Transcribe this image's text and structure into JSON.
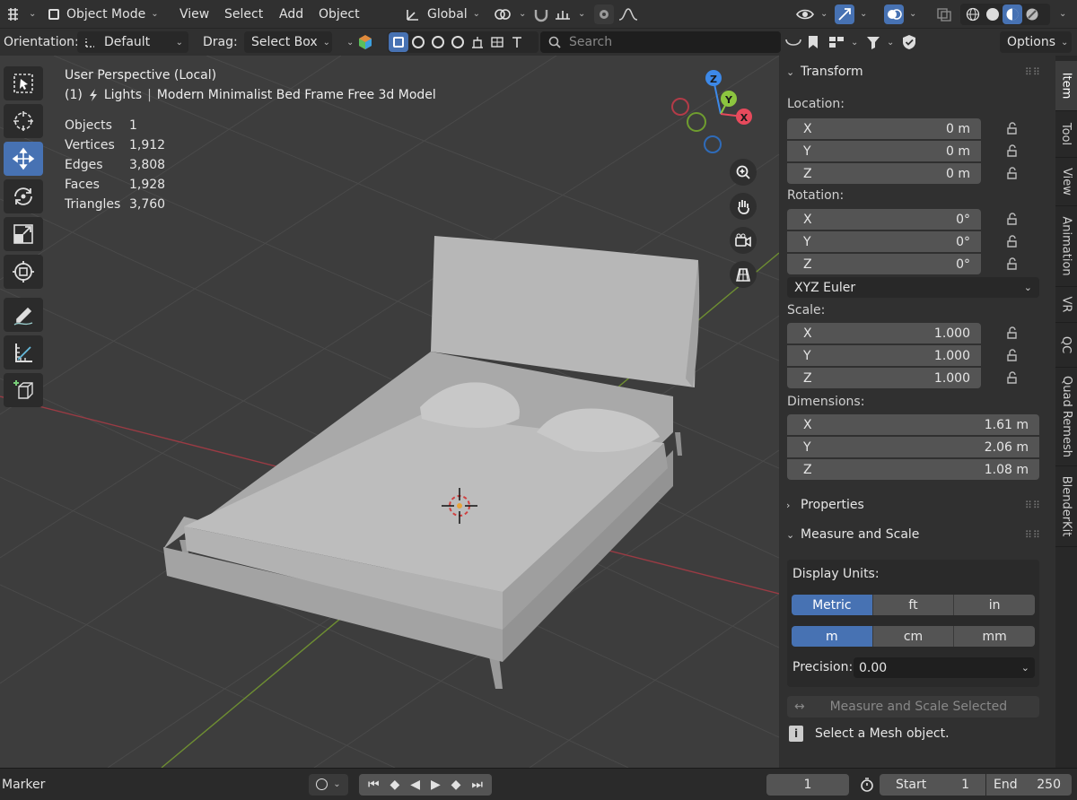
{
  "header": {
    "mode": "Object Mode",
    "menus": [
      "View",
      "Select",
      "Add",
      "Object"
    ],
    "transform_orientation": "Global",
    "options_label": "Options"
  },
  "toolsettings": {
    "orientation_label": "Orientation:",
    "orientation_value": "Default",
    "drag_label": "Drag:",
    "drag_value": "Select Box",
    "search_placeholder": "Search"
  },
  "viewport": {
    "view_name": "User Perspective (Local)",
    "frame_prefix": "(1)",
    "collection": "Lights",
    "object_name": "Modern Minimalist Bed Frame Free 3d Model",
    "stats": [
      {
        "label": "Objects",
        "value": "1"
      },
      {
        "label": "Vertices",
        "value": "1,912"
      },
      {
        "label": "Edges",
        "value": "3,808"
      },
      {
        "label": "Faces",
        "value": "1,928"
      },
      {
        "label": "Triangles",
        "value": "3,760"
      }
    ],
    "gizmo": {
      "x": "X",
      "y": "Y",
      "z": "Z"
    }
  },
  "sidebar": {
    "transform_title": "Transform",
    "location_label": "Location:",
    "location": [
      {
        "axis": "X",
        "value": "0 m"
      },
      {
        "axis": "Y",
        "value": "0 m"
      },
      {
        "axis": "Z",
        "value": "0 m"
      }
    ],
    "rotation_label": "Rotation:",
    "rotation": [
      {
        "axis": "X",
        "value": "0°"
      },
      {
        "axis": "Y",
        "value": "0°"
      },
      {
        "axis": "Z",
        "value": "0°"
      }
    ],
    "rotation_mode": "XYZ Euler",
    "scale_label": "Scale:",
    "scale": [
      {
        "axis": "X",
        "value": "1.000"
      },
      {
        "axis": "Y",
        "value": "1.000"
      },
      {
        "axis": "Z",
        "value": "1.000"
      }
    ],
    "dimensions_label": "Dimensions:",
    "dimensions": [
      {
        "axis": "X",
        "value": "1.61 m"
      },
      {
        "axis": "Y",
        "value": "2.06 m"
      },
      {
        "axis": "Z",
        "value": "1.08 m"
      }
    ],
    "properties_title": "Properties",
    "measure_title": "Measure and Scale",
    "display_units_label": "Display Units:",
    "unit_systems": [
      "Metric",
      "ft",
      "in"
    ],
    "length_units": [
      "m",
      "cm",
      "mm"
    ],
    "precision_label": "Precision:",
    "precision_value": "0.00",
    "measure_button": "Measure and Scale Selected",
    "info_text": "Select a Mesh object."
  },
  "tabs": [
    "Item",
    "Tool",
    "View",
    "Animation",
    "VR",
    "QC",
    "Quad Remesh",
    "BlenderKit"
  ],
  "timeline": {
    "marker_label": "Marker",
    "current_frame": "1",
    "start_label": "Start",
    "start_value": "1",
    "end_label": "End",
    "end_value": "250"
  },
  "colors": {
    "accent": "#4772b3",
    "axis_x": "#e74a5c",
    "axis_y": "#8cc53f",
    "axis_z": "#3d89e8"
  }
}
